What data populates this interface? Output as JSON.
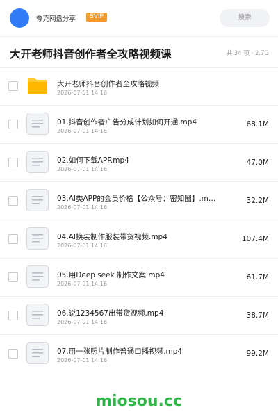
{
  "header": {
    "app_name": "夸克网盘分享",
    "badge": "SVIP",
    "search_placeholder": "搜索"
  },
  "folder": {
    "title": "大开老师抖音创作者全攻略视频课",
    "count_text": "共 34 项 · 2.7G"
  },
  "files": [
    {
      "name": "大开老师抖音创作者全攻略视频",
      "date": "2026-07-01 14:16",
      "size": "",
      "icon": "folder-icon"
    },
    {
      "name": "01.抖音创作者广告分成计划如何开通.mp4",
      "date": "2026-07-01 14:16",
      "size": "68.1M",
      "icon": "document-icon"
    },
    {
      "name": "02.如何下载APP.mp4",
      "date": "2026-07-01 14:16",
      "size": "47.0M",
      "icon": "document-icon"
    },
    {
      "name": "03.AI类APP的会员价格【公众号：密知圈】.m…",
      "date": "2026-07-01 14:16",
      "size": "32.2M",
      "icon": "document-icon"
    },
    {
      "name": "04.AI换装制作服装带货视频.mp4",
      "date": "2026-07-01 14:16",
      "size": "107.4M",
      "icon": "document-icon"
    },
    {
      "name": "05.用Deep seek 制作文案.mp4",
      "date": "2026-07-01 14:16",
      "size": "61.7M",
      "icon": "document-icon"
    },
    {
      "name": "06.说1234567出带货视频.mp4",
      "date": "2026-07-01 14:16",
      "size": "38.7M",
      "icon": "document-icon"
    },
    {
      "name": "07.用一张照片制作普通口播视频.mp4",
      "date": "2026-07-01 14:16",
      "size": "99.2M",
      "icon": "document-icon"
    }
  ],
  "watermark": "miosou.cc",
  "colors": {
    "accent": "#2f7cf6",
    "badge": "#f59b2b",
    "folder": "#ffc933",
    "watermark": "#2fb548"
  }
}
